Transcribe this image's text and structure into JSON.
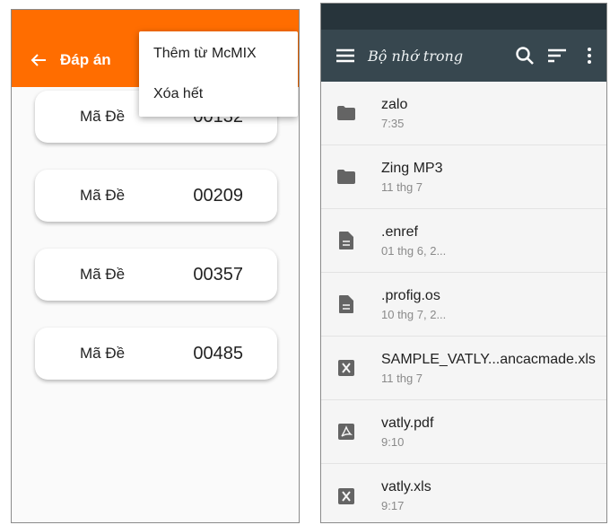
{
  "left_screen": {
    "title": "Đáp án",
    "menu": [
      "Thêm từ McMIX",
      "Xóa hết"
    ],
    "cards": [
      {
        "label": "Mã Đề",
        "code": "00132"
      },
      {
        "label": "Mã Đề",
        "code": "00209"
      },
      {
        "label": "Mã Đề",
        "code": "00357"
      },
      {
        "label": "Mã Đề",
        "code": "00485"
      }
    ],
    "colors": {
      "appbar": "#ff6d00",
      "background": "#fafafa"
    }
  },
  "right_screen": {
    "title": "Bộ nhớ trong",
    "toolbar_icons": [
      "search-icon",
      "sort-icon",
      "more-vert-icon"
    ],
    "files": [
      {
        "name": "zalo",
        "date": "7:35",
        "icon": "folder-icon"
      },
      {
        "name": "Zing MP3",
        "date": "11 thg 7",
        "icon": "folder-icon"
      },
      {
        "name": ".enref",
        "date": "01 thg 6, 2...",
        "icon": "document-icon"
      },
      {
        "name": ".profig.os",
        "date": "10 thg 7, 2...",
        "icon": "document-icon"
      },
      {
        "name": "SAMPLE_VATLY...ancacmade.xls",
        "date": "11 thg 7",
        "icon": "excel-file-icon"
      },
      {
        "name": "vatly.pdf",
        "date": "9:10",
        "icon": "pdf-file-icon"
      },
      {
        "name": "vatly.xls",
        "date": "9:17",
        "icon": "excel-file-icon"
      }
    ],
    "colors": {
      "appbar": "#37474f",
      "status_bar": "#27343b",
      "background": "#f5f5f5"
    }
  }
}
